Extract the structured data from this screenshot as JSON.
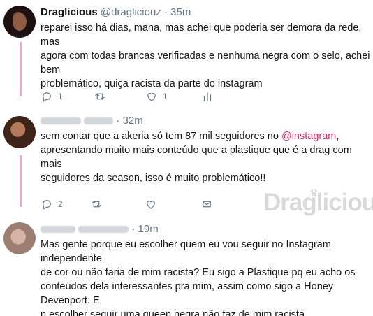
{
  "tweets": [
    {
      "name": "Draglicious",
      "handle": "@dragliciouz",
      "separator": "·",
      "time": "35m",
      "text": "reparei isso há dias, mana, mas achei que poderia ser demora da rede, mas\nagora com todas brancas verificadas e nenhuma negra com o selo, achei bem\nproblemático, quiça racista da parte do instagram",
      "actions": {
        "reply_count": "1",
        "retweet_count": "",
        "like_count": "1"
      }
    },
    {
      "separator": "·",
      "time": "32m",
      "text_before": "sem contar que a akeria só tem 87 mil seguidores no ",
      "mention": "@instagram",
      "text_after": ",\napresentando muito mais conteúdo que a plastique que é a drag com mais\nseguidores da season, isso é muito problemático!!",
      "actions": {
        "reply_count": "2",
        "retweet_count": "",
        "like_count": ""
      }
    },
    {
      "separator": "·",
      "time": "19m",
      "text": "Mas gente porque eu escolher quem eu vou seguir no Instagram independente\nde cor ou não faria de mim racista? Eu sigo a Plastique pq eu acho os\nconteúdos dela interessantes pra mim, assim como sigo a Honey Devenport. E\nn escolher seguir uma queen negra não faz de mim racista."
    }
  ],
  "watermark": {
    "text": "Draglicious"
  },
  "icons": {
    "reply": "reply-icon",
    "retweet": "retweet-icon",
    "like": "heart-icon",
    "analytics": "analytics-icon",
    "message": "envelope-icon"
  },
  "colors": {
    "thread_line": "#f2a7cf",
    "mention": "#e0245e",
    "secondary_text": "#657786"
  }
}
